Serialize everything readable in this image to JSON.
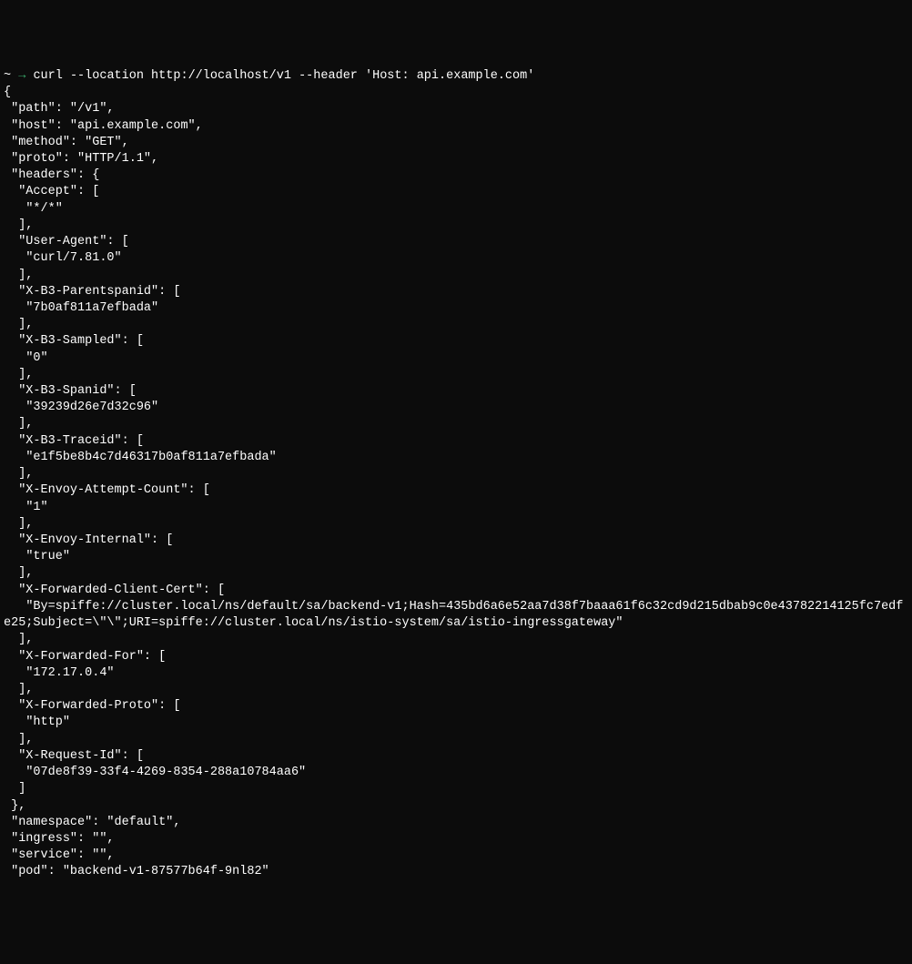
{
  "prompt": {
    "tilde": "~",
    "arrow": "→",
    "command": "curl --location http://localhost/v1 --header 'Host: api.example.com'"
  },
  "output": {
    "l01": "{",
    "l02": " \"path\": \"/v1\",",
    "l03": " \"host\": \"api.example.com\",",
    "l04": " \"method\": \"GET\",",
    "l05": " \"proto\": \"HTTP/1.1\",",
    "l06": " \"headers\": {",
    "l07": "  \"Accept\": [",
    "l08": "   \"*/*\"",
    "l09": "  ],",
    "l10": "  \"User-Agent\": [",
    "l11": "   \"curl/7.81.0\"",
    "l12": "  ],",
    "l13": "  \"X-B3-Parentspanid\": [",
    "l14": "   \"7b0af811a7efbada\"",
    "l15": "  ],",
    "l16": "  \"X-B3-Sampled\": [",
    "l17": "   \"0\"",
    "l18": "  ],",
    "l19": "  \"X-B3-Spanid\": [",
    "l20": "   \"39239d26e7d32c96\"",
    "l21": "  ],",
    "l22": "  \"X-B3-Traceid\": [",
    "l23": "   \"e1f5be8b4c7d46317b0af811a7efbada\"",
    "l24": "  ],",
    "l25": "  \"X-Envoy-Attempt-Count\": [",
    "l26": "   \"1\"",
    "l27": "  ],",
    "l28": "  \"X-Envoy-Internal\": [",
    "l29": "   \"true\"",
    "l30": "  ],",
    "l31": "  \"X-Forwarded-Client-Cert\": [",
    "l32": "   \"By=spiffe://cluster.local/ns/default/sa/backend-v1;Hash=435bd6a6e52aa7d38f7baaa61f6c32cd9d215dbab9c0e43782214125fc7edfe25;Subject=\\\"\\\";URI=spiffe://cluster.local/ns/istio-system/sa/istio-ingressgateway\"",
    "l33": "  ],",
    "l34": "  \"X-Forwarded-For\": [",
    "l35": "   \"172.17.0.4\"",
    "l36": "  ],",
    "l37": "  \"X-Forwarded-Proto\": [",
    "l38": "   \"http\"",
    "l39": "  ],",
    "l40": "  \"X-Request-Id\": [",
    "l41": "   \"07de8f39-33f4-4269-8354-288a10784aa6\"",
    "l42": "  ]",
    "l43": " },",
    "l44": " \"namespace\": \"default\",",
    "l45": " \"ingress\": \"\",",
    "l46": " \"service\": \"\",",
    "l47": " \"pod\": \"backend-v1-87577b64f-9nl82\""
  }
}
